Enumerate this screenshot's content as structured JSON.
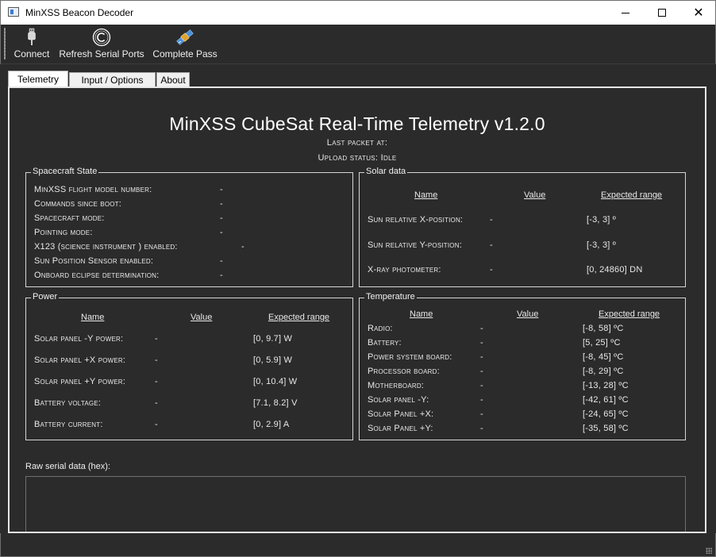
{
  "window": {
    "title": "MinXSS Beacon Decoder"
  },
  "icons": {
    "app": "app-window-icon",
    "connect": "usb-plug-icon",
    "refresh": "copyright-circle-icon",
    "pass": "satellite-icon",
    "minimize": "minimize-icon",
    "maximize": "maximize-icon",
    "close": "close-icon"
  },
  "toolbar": {
    "connect_label": "Connect",
    "refresh_label": "Refresh Serial Ports",
    "pass_label": "Complete Pass"
  },
  "tabs": [
    {
      "label": "Telemetry",
      "active": true
    },
    {
      "label": "Input / Options",
      "active": false
    },
    {
      "label": "About",
      "active": false
    }
  ],
  "telemetry": {
    "title": "MinXSS CubeSat Real-Time Telemetry v1.2.0",
    "last_packet": "Last packet at:",
    "upload_status": "Upload status: Idle",
    "spacecraft_state": {
      "title": "Spacecraft State",
      "rows": [
        {
          "label": "MinXSS flight model number:",
          "value": "-"
        },
        {
          "label": "Commands since boot:",
          "value": "-"
        },
        {
          "label": "Spacecraft mode:",
          "value": "-"
        },
        {
          "label": "Pointing mode:",
          "value": "-"
        },
        {
          "label": "X123 (science instrument ) enabled:",
          "value": "-"
        },
        {
          "label": "Sun Position Sensor enabled:",
          "value": "-"
        },
        {
          "label": "Onboard eclipse determination:",
          "value": "-"
        }
      ]
    },
    "solar_data": {
      "title": "Solar data",
      "headers": {
        "name": "Name",
        "value": "Value",
        "range": "Expected range"
      },
      "rows": [
        {
          "label": "Sun relative X-position:",
          "value": "-",
          "range": "[-3, 3] º"
        },
        {
          "label": "Sun relative Y-position:",
          "value": "-",
          "range": "[-3, 3] º"
        },
        {
          "label": "X-ray photometer:",
          "value": "-",
          "range": "[0, 24860] DN"
        }
      ]
    },
    "power": {
      "title": "Power",
      "headers": {
        "name": "Name",
        "value": "Value",
        "range": "Expected range"
      },
      "rows": [
        {
          "label": "Solar panel -Y power:",
          "value": "-",
          "range": "[0, 9.7] W"
        },
        {
          "label": "Solar panel +X power:",
          "value": "-",
          "range": "[0, 5.9] W"
        },
        {
          "label": "Solar panel +Y power:",
          "value": "-",
          "range": "[0, 10.4] W"
        },
        {
          "label": "Battery voltage:",
          "value": "-",
          "range": "[7.1, 8.2] V"
        },
        {
          "label": "Battery current:",
          "value": "-",
          "range": "[0, 2.9] A"
        }
      ]
    },
    "temperature": {
      "title": "Temperature",
      "headers": {
        "name": "Name",
        "value": "Value",
        "range": "Expected range"
      },
      "rows": [
        {
          "label": "Radio:",
          "value": "-",
          "range": "[-8, 58] ºC"
        },
        {
          "label": "Battery:",
          "value": "-",
          "range": "[5, 25] ºC"
        },
        {
          "label": "Power system board:",
          "value": "-",
          "range": "[-8, 45] ºC"
        },
        {
          "label": "Processor board:",
          "value": "-",
          "range": "[-8, 29] ºC"
        },
        {
          "label": "Motherboard:",
          "value": "-",
          "range": "[-13, 28] ºC"
        },
        {
          "label": "Solar panel -Y:",
          "value": "-",
          "range": "[-42, 61] ºC"
        },
        {
          "label": "Solar Panel +X:",
          "value": "-",
          "range": "[-24, 65] ºC"
        },
        {
          "label": "Solar Panel +Y:",
          "value": "-",
          "range": "[-35, 58] ºC"
        }
      ]
    },
    "raw_serial_label": "Raw serial data (hex):",
    "raw_serial_value": ""
  }
}
